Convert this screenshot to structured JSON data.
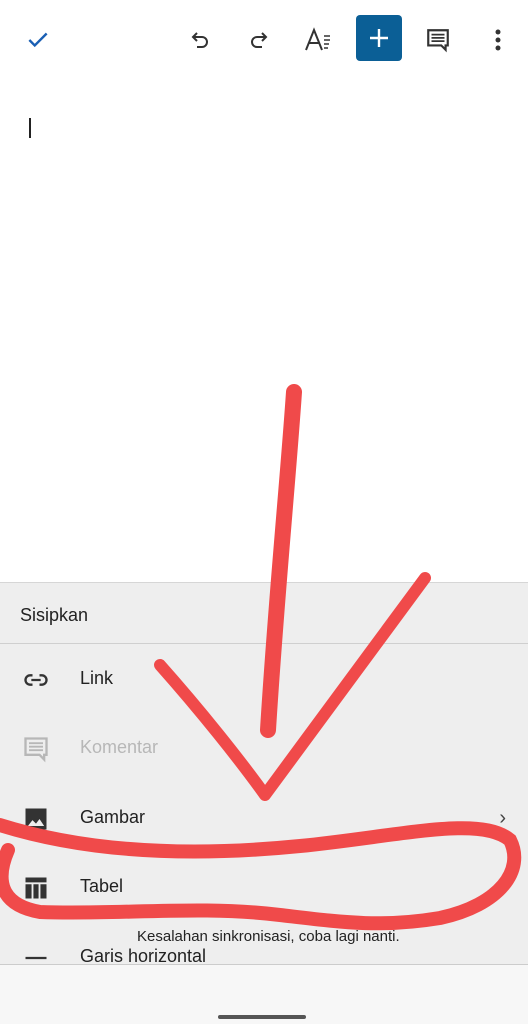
{
  "toolbar": {
    "icons": [
      "check-icon",
      "undo-icon",
      "redo-icon",
      "text-format-icon",
      "insert-plus-icon",
      "comment-icon",
      "more-vert-icon"
    ],
    "accent": "#0b5f96"
  },
  "sheet": {
    "title": "Sisipkan",
    "items": [
      {
        "label": "Link",
        "icon": "link-icon",
        "enabled": true
      },
      {
        "label": "Komentar",
        "icon": "comment-icon",
        "enabled": false
      },
      {
        "label": "Gambar",
        "icon": "image-icon",
        "enabled": true,
        "submenu": true
      },
      {
        "label": "Tabel",
        "icon": "table-icon",
        "enabled": true,
        "submenu": true
      },
      {
        "label": "Garis horizontal",
        "icon": "horizontal-line-icon",
        "enabled": true
      }
    ]
  },
  "toast": "Kesalahan sinkronisasi, coba lagi nanti.",
  "annotation_color": "#f04a4a"
}
